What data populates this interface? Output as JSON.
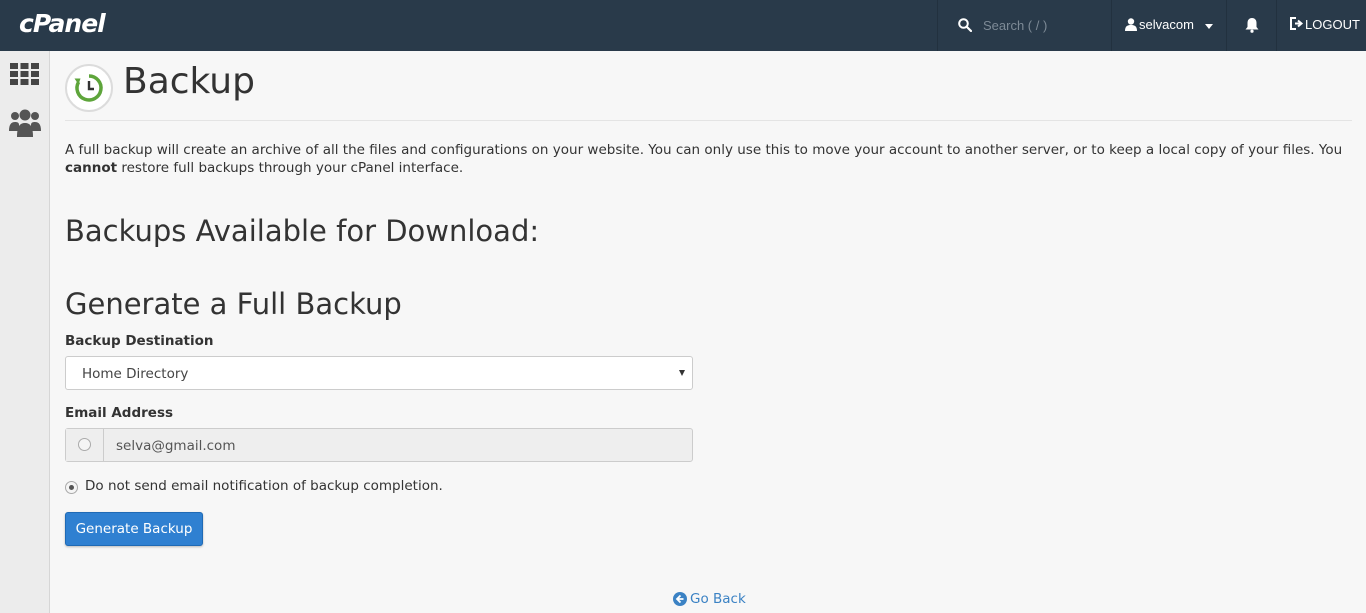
{
  "header": {
    "logo": "cPanel",
    "search_placeholder": "Search ( / )",
    "username": "selvacom",
    "logout_label": "LOGOUT"
  },
  "sidebar": {
    "items": [
      {
        "icon": "grid-icon"
      },
      {
        "icon": "users-icon"
      }
    ]
  },
  "page": {
    "title": "Backup",
    "description_pre": "A full backup will create an archive of all the files and configurations on your website. You can only use this to move your account to another server, or to keep a local copy of your files. You ",
    "description_bold": "cannot",
    "description_post": " restore full backups through your cPanel interface.",
    "available_heading": "Backups Available for Download:",
    "generate_heading": "Generate a Full Backup",
    "destination_label": "Backup Destination",
    "destination_value": "Home Directory",
    "email_label": "Email Address",
    "email_value": "selva@gmail.com",
    "no_email_label": "Do not send email notification of backup completion.",
    "generate_button": "Generate Backup",
    "go_back": "Go Back"
  },
  "colors": {
    "topbar": "#293a4a",
    "primary_button": "#2f80d1",
    "link": "#3b82c4",
    "icon_green": "#5ea53b"
  }
}
